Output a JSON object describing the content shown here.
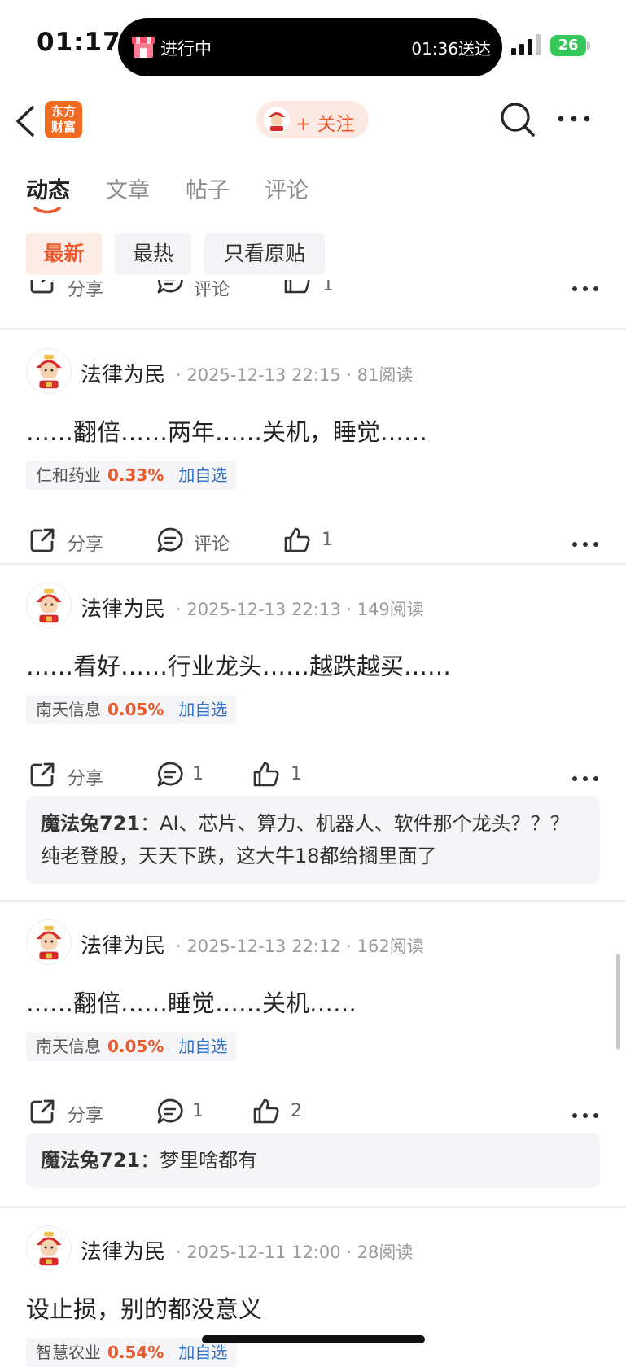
{
  "status_bar": {
    "time": "01:17",
    "activity_label": "进行中",
    "eta": "01:36送达",
    "battery": "26"
  },
  "nav": {
    "logo_text": "东方财富",
    "follow_label": "+ 关注"
  },
  "tabs": [
    {
      "label": "动态",
      "active": true
    },
    {
      "label": "文章",
      "active": false
    },
    {
      "label": "帖子",
      "active": false
    },
    {
      "label": "评论",
      "active": false
    }
  ],
  "filters": [
    {
      "label": "最新",
      "active": true
    },
    {
      "label": "最热",
      "active": false
    },
    {
      "label": "只看原贴",
      "active": false
    }
  ],
  "partial_post": {
    "share": "分享",
    "comment": "评论",
    "like": "1"
  },
  "posts": [
    {
      "user": "法律为民",
      "date": "2025-12-13 22:15",
      "reads": "81阅读",
      "content": "……翻倍……两年……关机，睡觉……",
      "stock": {
        "name": "仁和药业",
        "change": "0.33%",
        "add": "加自选"
      },
      "actions": {
        "share": "分享",
        "comment": "评论",
        "like": "1"
      }
    },
    {
      "user": "法律为民",
      "date": "2025-12-13 22:13",
      "reads": "149阅读",
      "content": "……看好……行业龙头……越跌越买……",
      "stock": {
        "name": "南天信息",
        "change": "0.05%",
        "add": "加自选"
      },
      "actions": {
        "share": "分享",
        "comment": "1",
        "like": "1"
      },
      "reply": {
        "user": "魔法兔721",
        "text": "AI、芯片、算力、机器人、软件那个龙头？？？ 纯老登股，天天下跌，这大牛18都给搁里面了"
      }
    },
    {
      "user": "法律为民",
      "date": "2025-12-13 22:12",
      "reads": "162阅读",
      "content": "……翻倍……睡觉……关机……",
      "stock": {
        "name": "南天信息",
        "change": "0.05%",
        "add": "加自选"
      },
      "actions": {
        "share": "分享",
        "comment": "1",
        "like": "2"
      },
      "reply": {
        "user": "魔法兔721",
        "text": "梦里啥都有"
      }
    },
    {
      "user": "法律为民",
      "date": "2025-12-11 12:00",
      "reads": "28阅读",
      "content": "设止损，别的都没意义",
      "stock": {
        "name": "智慧农业",
        "change": "0.54%",
        "add": "加自选"
      }
    }
  ],
  "colors": {
    "accent": "#ea5a2d",
    "link": "#2d6fcc",
    "logo_bg": "#f06a22",
    "battery": "#34c759"
  }
}
